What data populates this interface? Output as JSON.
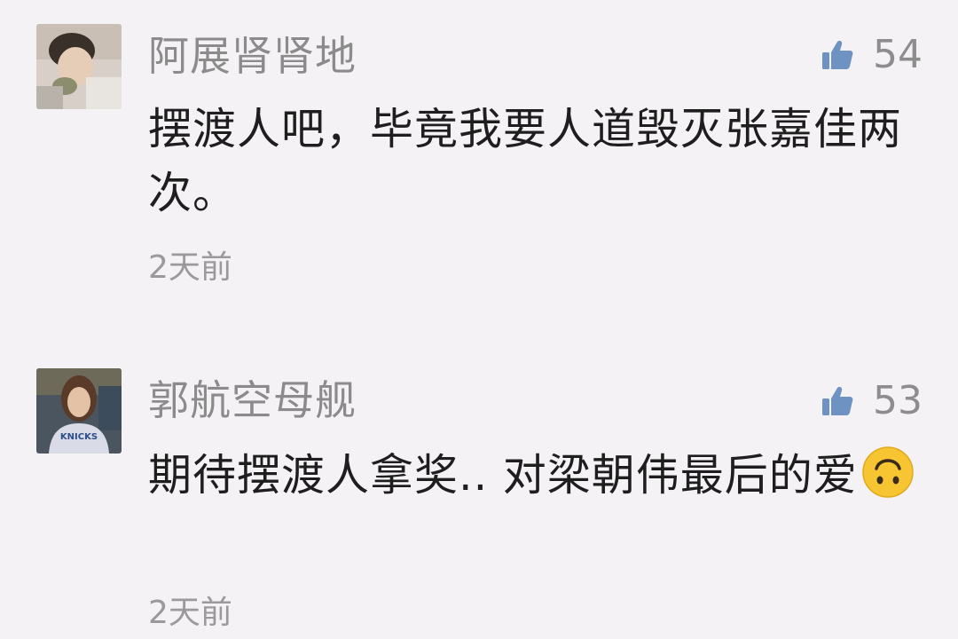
{
  "comments": [
    {
      "username": "阿展肾肾地",
      "likes": "54",
      "content": "摆渡人吧，毕竟我要人道毁灭张嘉佳两次。",
      "time": "2天前",
      "avatar": "avatar-photo-person-eating"
    },
    {
      "username": "郭航空母舰",
      "likes": "53",
      "content": "期待摆渡人拿奖.. 对梁朝伟最后的爱",
      "content_emoji": "upside-down-face-emoji",
      "time": "2天前",
      "avatar": "avatar-photo-person-knicks-shirt",
      "avatar_shirt_text": "KNICKS"
    }
  ],
  "colors": {
    "background": "#f5f2f5",
    "like_icon": "#6e93c2",
    "username": "#8b8b8b",
    "content": "#1e1e1e",
    "time": "#9a9a9a"
  }
}
